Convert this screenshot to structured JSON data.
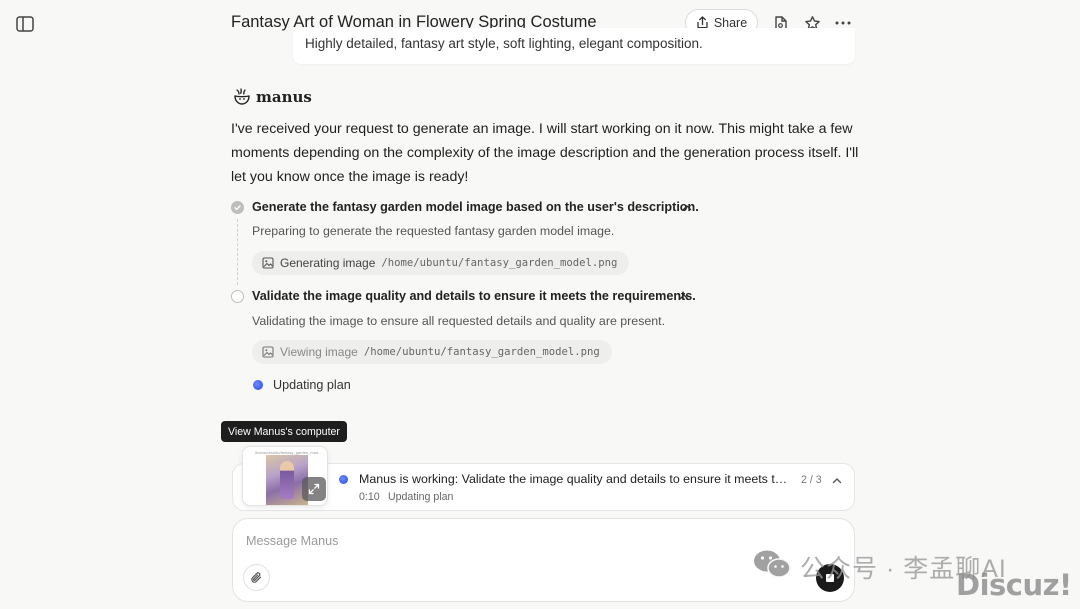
{
  "header": {
    "title": "Fantasy Art of Woman in Flowery Spring Costume",
    "share_label": "Share"
  },
  "user_message": {
    "visible_text": "Highly detailed, fantasy art style, soft lighting, elegant composition."
  },
  "assistant": {
    "name": "manus",
    "reply": "I've received your request to generate an image. I will start working on it now. This might take a few moments depending on the complexity of the image description and the generation process itself. I'll let you know once the image is ready!"
  },
  "steps": [
    {
      "title": "Generate the fantasy garden model image based on the user's description.",
      "status": "done",
      "description": "Preparing to generate the requested fantasy garden model image.",
      "action": "Generating image",
      "path": "/home/ubuntu/fantasy_garden_model.png"
    },
    {
      "title": "Validate the image quality and details to ensure it meets the requirements.",
      "status": "in-progress",
      "description": "Validating the image to ensure all requested details and quality are present.",
      "action": "Viewing image",
      "path": "/home/ubuntu/fantasy_garden_model.png"
    }
  ],
  "updating_plan": "Updating plan",
  "tooltip": "View Manus's computer",
  "thumbnail_caption": "/home/ubuntu/fantasy_garden_mod...",
  "status": {
    "text": "Manus is working: Validate the image quality and details to ensure it meets the requirements.",
    "time": "0:10",
    "sub": "Updating plan",
    "count": "2 / 3"
  },
  "composer": {
    "placeholder": "Message Manus"
  },
  "watermark": {
    "text": "公众号 · 李孟聊AI",
    "site": "Discuz!"
  },
  "colors": {
    "background": "#f8f8f7",
    "accent_dot": "#2347e0",
    "stop_button": "#1a1a1a"
  }
}
